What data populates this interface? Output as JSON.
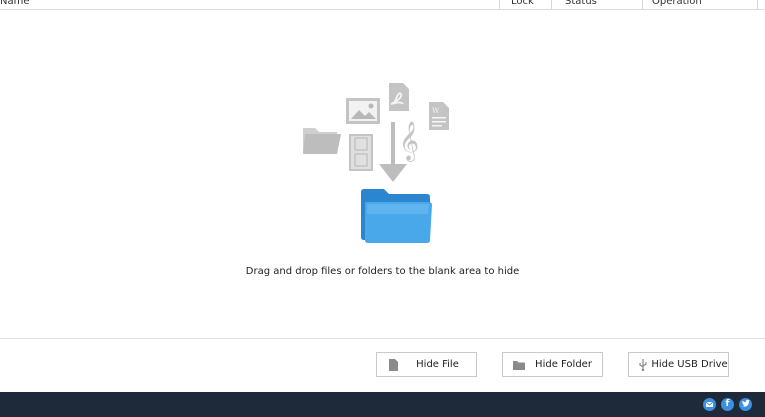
{
  "columns": {
    "name": "Name",
    "lock": "Lock",
    "status": "Status",
    "operation": "Operation"
  },
  "drop_hint": "Drag and drop files or folders to the blank area to hide",
  "buttons": {
    "hide_file": "Hide File",
    "hide_folder": "Hide Folder",
    "hide_usb": "Hide USB Drive"
  },
  "social": {
    "mail_icon": "mail-icon",
    "facebook_icon": "facebook-icon",
    "twitter_icon": "twitter-icon"
  },
  "colors": {
    "footer_bg": "#1e2a39",
    "accent_blue": "#3d8fe0",
    "folder_blue": "#3b9ee2",
    "gray_icon": "#c8c8c8"
  }
}
